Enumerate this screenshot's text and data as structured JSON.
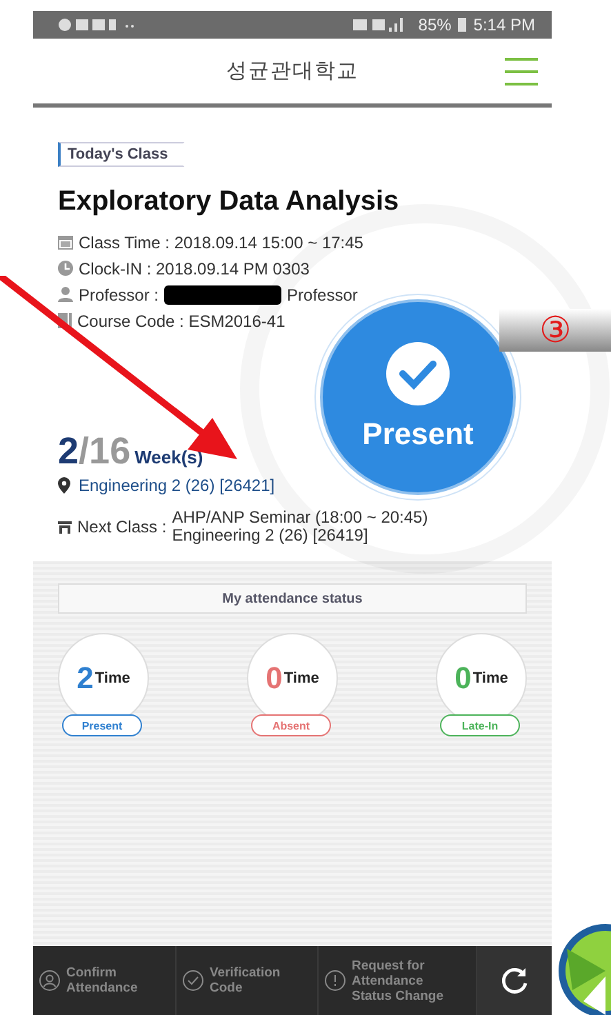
{
  "status_bar": {
    "battery": "85%",
    "time": "5:14 PM"
  },
  "header": {
    "title": "성균관대학교"
  },
  "today": {
    "tag": "Today's Class",
    "course": "Exploratory Data Analysis",
    "info": [
      {
        "kind": "calendar",
        "text": "Class Time : 2018.09.14 15:00 ~ 17:45"
      },
      {
        "kind": "clock",
        "text": "Clock-IN : 2018.09.14 PM 0303"
      },
      {
        "kind": "person",
        "text": "Professor :",
        "suffix": "Professor"
      },
      {
        "kind": "book",
        "text": "Course Code : ESM2016-41"
      }
    ],
    "week": {
      "current": "2",
      "slash": "/",
      "total": "16",
      "unit": "Week(s)"
    },
    "location": "Engineering 2 (26) [26421]",
    "next_class": {
      "label": "Next Class :",
      "lines": [
        "AHP/ANP Seminar (18:00 ~ 20:45)",
        "Engineering 2 (26) [26419]"
      ]
    },
    "present_button": "Present"
  },
  "attendance": {
    "title": "My attendance status",
    "items": [
      {
        "count": "2",
        "unit": "Time",
        "label": "Present",
        "color": "#2f80d0"
      },
      {
        "count": "0",
        "unit": "Time",
        "label": "Absent",
        "color": "#e57373"
      },
      {
        "count": "0",
        "unit": "Time",
        "label": "Late-In",
        "color": "#4cb35a"
      }
    ]
  },
  "bottom_bar": [
    {
      "kind": "person",
      "label": "Confirm Attendance"
    },
    {
      "kind": "check",
      "label": "Verification Code"
    },
    {
      "kind": "alert",
      "label": "Request for Attendance Status Change"
    }
  ],
  "annotation": {
    "badge": "③"
  }
}
